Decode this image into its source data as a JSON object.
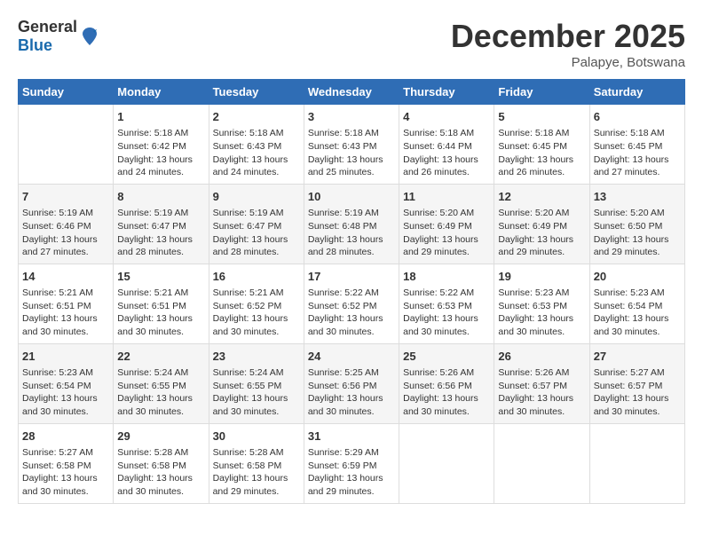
{
  "header": {
    "logo_general": "General",
    "logo_blue": "Blue",
    "month_title": "December 2025",
    "location": "Palapye, Botswana"
  },
  "days_of_week": [
    "Sunday",
    "Monday",
    "Tuesday",
    "Wednesday",
    "Thursday",
    "Friday",
    "Saturday"
  ],
  "weeks": [
    [
      {
        "day": "",
        "sunrise": "",
        "sunset": "",
        "daylight": ""
      },
      {
        "day": "1",
        "sunrise": "Sunrise: 5:18 AM",
        "sunset": "Sunset: 6:42 PM",
        "daylight": "Daylight: 13 hours and 24 minutes."
      },
      {
        "day": "2",
        "sunrise": "Sunrise: 5:18 AM",
        "sunset": "Sunset: 6:43 PM",
        "daylight": "Daylight: 13 hours and 24 minutes."
      },
      {
        "day": "3",
        "sunrise": "Sunrise: 5:18 AM",
        "sunset": "Sunset: 6:43 PM",
        "daylight": "Daylight: 13 hours and 25 minutes."
      },
      {
        "day": "4",
        "sunrise": "Sunrise: 5:18 AM",
        "sunset": "Sunset: 6:44 PM",
        "daylight": "Daylight: 13 hours and 26 minutes."
      },
      {
        "day": "5",
        "sunrise": "Sunrise: 5:18 AM",
        "sunset": "Sunset: 6:45 PM",
        "daylight": "Daylight: 13 hours and 26 minutes."
      },
      {
        "day": "6",
        "sunrise": "Sunrise: 5:18 AM",
        "sunset": "Sunset: 6:45 PM",
        "daylight": "Daylight: 13 hours and 27 minutes."
      }
    ],
    [
      {
        "day": "7",
        "sunrise": "Sunrise: 5:19 AM",
        "sunset": "Sunset: 6:46 PM",
        "daylight": "Daylight: 13 hours and 27 minutes."
      },
      {
        "day": "8",
        "sunrise": "Sunrise: 5:19 AM",
        "sunset": "Sunset: 6:47 PM",
        "daylight": "Daylight: 13 hours and 28 minutes."
      },
      {
        "day": "9",
        "sunrise": "Sunrise: 5:19 AM",
        "sunset": "Sunset: 6:47 PM",
        "daylight": "Daylight: 13 hours and 28 minutes."
      },
      {
        "day": "10",
        "sunrise": "Sunrise: 5:19 AM",
        "sunset": "Sunset: 6:48 PM",
        "daylight": "Daylight: 13 hours and 28 minutes."
      },
      {
        "day": "11",
        "sunrise": "Sunrise: 5:20 AM",
        "sunset": "Sunset: 6:49 PM",
        "daylight": "Daylight: 13 hours and 29 minutes."
      },
      {
        "day": "12",
        "sunrise": "Sunrise: 5:20 AM",
        "sunset": "Sunset: 6:49 PM",
        "daylight": "Daylight: 13 hours and 29 minutes."
      },
      {
        "day": "13",
        "sunrise": "Sunrise: 5:20 AM",
        "sunset": "Sunset: 6:50 PM",
        "daylight": "Daylight: 13 hours and 29 minutes."
      }
    ],
    [
      {
        "day": "14",
        "sunrise": "Sunrise: 5:21 AM",
        "sunset": "Sunset: 6:51 PM",
        "daylight": "Daylight: 13 hours and 30 minutes."
      },
      {
        "day": "15",
        "sunrise": "Sunrise: 5:21 AM",
        "sunset": "Sunset: 6:51 PM",
        "daylight": "Daylight: 13 hours and 30 minutes."
      },
      {
        "day": "16",
        "sunrise": "Sunrise: 5:21 AM",
        "sunset": "Sunset: 6:52 PM",
        "daylight": "Daylight: 13 hours and 30 minutes."
      },
      {
        "day": "17",
        "sunrise": "Sunrise: 5:22 AM",
        "sunset": "Sunset: 6:52 PM",
        "daylight": "Daylight: 13 hours and 30 minutes."
      },
      {
        "day": "18",
        "sunrise": "Sunrise: 5:22 AM",
        "sunset": "Sunset: 6:53 PM",
        "daylight": "Daylight: 13 hours and 30 minutes."
      },
      {
        "day": "19",
        "sunrise": "Sunrise: 5:23 AM",
        "sunset": "Sunset: 6:53 PM",
        "daylight": "Daylight: 13 hours and 30 minutes."
      },
      {
        "day": "20",
        "sunrise": "Sunrise: 5:23 AM",
        "sunset": "Sunset: 6:54 PM",
        "daylight": "Daylight: 13 hours and 30 minutes."
      }
    ],
    [
      {
        "day": "21",
        "sunrise": "Sunrise: 5:23 AM",
        "sunset": "Sunset: 6:54 PM",
        "daylight": "Daylight: 13 hours and 30 minutes."
      },
      {
        "day": "22",
        "sunrise": "Sunrise: 5:24 AM",
        "sunset": "Sunset: 6:55 PM",
        "daylight": "Daylight: 13 hours and 30 minutes."
      },
      {
        "day": "23",
        "sunrise": "Sunrise: 5:24 AM",
        "sunset": "Sunset: 6:55 PM",
        "daylight": "Daylight: 13 hours and 30 minutes."
      },
      {
        "day": "24",
        "sunrise": "Sunrise: 5:25 AM",
        "sunset": "Sunset: 6:56 PM",
        "daylight": "Daylight: 13 hours and 30 minutes."
      },
      {
        "day": "25",
        "sunrise": "Sunrise: 5:26 AM",
        "sunset": "Sunset: 6:56 PM",
        "daylight": "Daylight: 13 hours and 30 minutes."
      },
      {
        "day": "26",
        "sunrise": "Sunrise: 5:26 AM",
        "sunset": "Sunset: 6:57 PM",
        "daylight": "Daylight: 13 hours and 30 minutes."
      },
      {
        "day": "27",
        "sunrise": "Sunrise: 5:27 AM",
        "sunset": "Sunset: 6:57 PM",
        "daylight": "Daylight: 13 hours and 30 minutes."
      }
    ],
    [
      {
        "day": "28",
        "sunrise": "Sunrise: 5:27 AM",
        "sunset": "Sunset: 6:58 PM",
        "daylight": "Daylight: 13 hours and 30 minutes."
      },
      {
        "day": "29",
        "sunrise": "Sunrise: 5:28 AM",
        "sunset": "Sunset: 6:58 PM",
        "daylight": "Daylight: 13 hours and 30 minutes."
      },
      {
        "day": "30",
        "sunrise": "Sunrise: 5:28 AM",
        "sunset": "Sunset: 6:58 PM",
        "daylight": "Daylight: 13 hours and 29 minutes."
      },
      {
        "day": "31",
        "sunrise": "Sunrise: 5:29 AM",
        "sunset": "Sunset: 6:59 PM",
        "daylight": "Daylight: 13 hours and 29 minutes."
      },
      {
        "day": "",
        "sunrise": "",
        "sunset": "",
        "daylight": ""
      },
      {
        "day": "",
        "sunrise": "",
        "sunset": "",
        "daylight": ""
      },
      {
        "day": "",
        "sunrise": "",
        "sunset": "",
        "daylight": ""
      }
    ]
  ]
}
